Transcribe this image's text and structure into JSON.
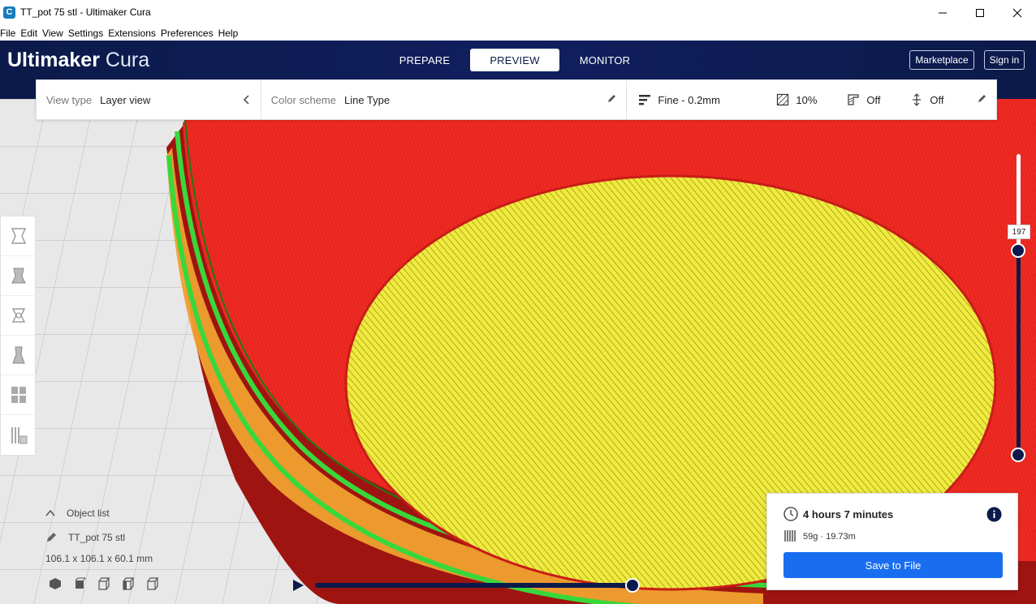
{
  "window": {
    "title": "TT_pot 75 stl - Ultimaker Cura",
    "app_icon_glyph": "C"
  },
  "menu": [
    "File",
    "Edit",
    "View",
    "Settings",
    "Extensions",
    "Preferences",
    "Help"
  ],
  "header": {
    "logo_bold": "Ultimaker",
    "logo_light": "Cura",
    "stages": [
      {
        "label": "PREPARE",
        "active": false
      },
      {
        "label": "PREVIEW",
        "active": true
      },
      {
        "label": "MONITOR",
        "active": false
      }
    ],
    "marketplace_label": "Marketplace",
    "signin_label": "Sign in"
  },
  "toolbar": {
    "view_type_label": "View type",
    "view_type_value": "Layer view",
    "color_scheme_label": "Color scheme",
    "color_scheme_value": "Line Type",
    "profile": "Fine - 0.2mm",
    "infill": "10%",
    "support": "Off",
    "adhesion": "Off"
  },
  "layer": {
    "current": "197",
    "progress_fraction": 0.7
  },
  "object_list": {
    "header": "Object list",
    "item": "TT_pot 75 stl",
    "dimensions": "106.1 x 106.1 x 60.1 mm"
  },
  "print_info": {
    "time": "4 hours 7 minutes",
    "material": "59g · 19.73m",
    "save_label": "Save to File"
  },
  "colors": {
    "header_bg": "#0b1a4a",
    "accent": "#196ef0",
    "wall_red": "#e82525",
    "top_yellow": "#f0ea3c",
    "inner_green": "#38d83b",
    "infill_orange": "#f0a030"
  }
}
